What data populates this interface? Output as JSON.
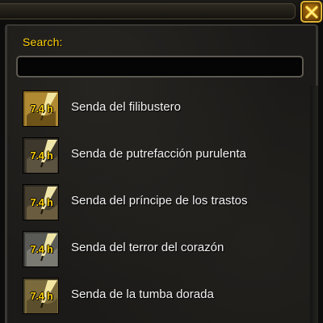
{
  "search": {
    "label": "Search:",
    "value": "",
    "placeholder": ""
  },
  "icons": {
    "close": "close-x-icon",
    "row": "map-quill-icon"
  },
  "colors": {
    "accent_gold": "#ffd100",
    "text": "#f2f2f2",
    "panel": "#1b1a18"
  },
  "rows": [
    {
      "badge": "7.4 h",
      "label": "Senda del filibustero"
    },
    {
      "badge": "7.4 h",
      "label": "Senda de putrefacción purulenta"
    },
    {
      "badge": "7.4 h",
      "label": "Senda del príncipe de los trastos"
    },
    {
      "badge": "7.4 h",
      "label": "Senda del terror del corazón"
    },
    {
      "badge": "7.4 h",
      "label": "Senda de la tumba dorada"
    }
  ]
}
